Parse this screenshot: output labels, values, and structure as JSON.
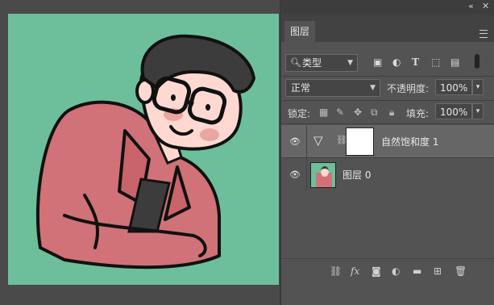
{
  "window": {
    "collapse_glyph": "«",
    "close_glyph": "✕"
  },
  "layers_panel": {
    "tab_label": "图层",
    "filter": {
      "kind_label": "类型"
    },
    "blend_mode": "正常",
    "opacity": {
      "label": "不透明度:",
      "value": "100%"
    },
    "lock": {
      "label": "锁定:"
    },
    "fill": {
      "label": "填充:",
      "value": "100%"
    },
    "layers": [
      {
        "name": "自然饱和度 1",
        "type": "adjustment-vibrance",
        "visible": true,
        "selected": true
      },
      {
        "name": "图层 0",
        "type": "pixel",
        "visible": true,
        "selected": false
      }
    ],
    "bottom_tools": [
      "link-icon",
      "fx-icon",
      "mask-icon",
      "adjustment-icon",
      "group-icon",
      "new-layer-icon",
      "delete-icon"
    ]
  },
  "colors": {
    "canvas_bg": "#6dbf9c",
    "shirt": "#d07277",
    "hair": "#3c3c3c",
    "skin": "#ffd9d1"
  }
}
